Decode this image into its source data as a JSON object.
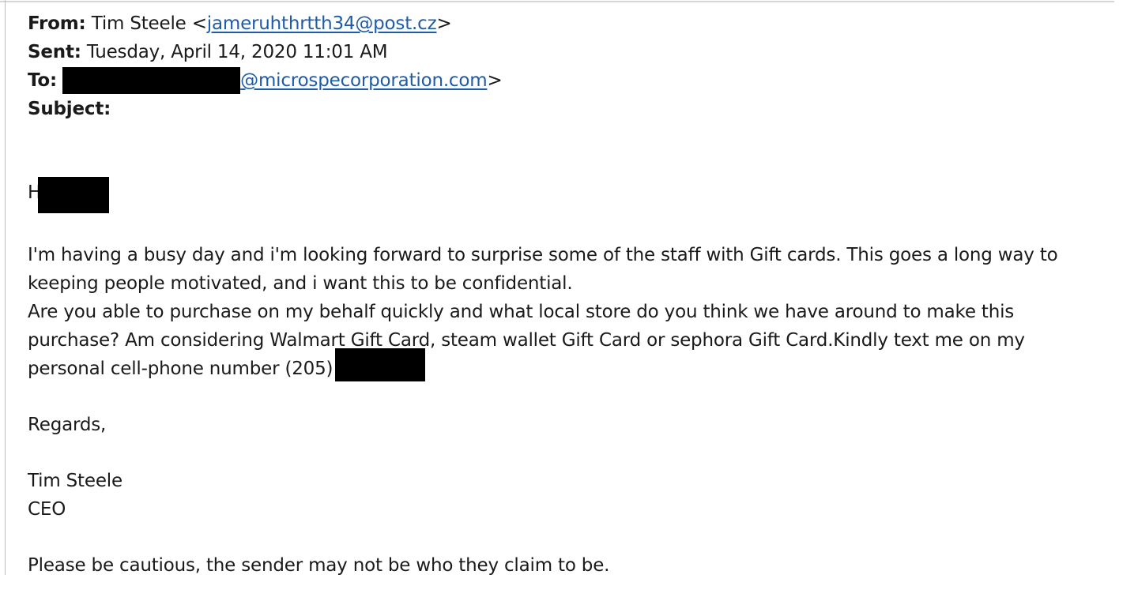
{
  "email": {
    "from_label": "From:",
    "from_name": "Tim Steele <",
    "from_address": "jameruhthrtth34@post.cz",
    "from_close": ">",
    "sent_label": "Sent:",
    "sent_value": "Tuesday, April 14, 2020 11:01 AM",
    "to_label": "To:",
    "to_domain": "@microspecorporation.com",
    "to_close": ">",
    "subject_label": "Subject:",
    "subject_value": ""
  },
  "body": {
    "greeting": "Hi",
    "line1": "I'm having a busy day and i'm looking forward to surprise some of the staff with Gift cards. This goes a long way to",
    "line2": "keeping people motivated, and i want this to be confidential.",
    "line3": "Are you able to purchase on my behalf quickly and what local store do you think we have around to make this",
    "line4": "purchase? Am considering Walmart Gift Card, steam wallet Gift Card or sephora Gift Card.Kindly text me on my",
    "line5": "personal cell-phone number (205) ",
    "closing": "Regards,",
    "signature_name": "Tim Steele",
    "signature_title": "CEO",
    "warning": "Please be cautious, the sender may not be who they claim to be."
  }
}
